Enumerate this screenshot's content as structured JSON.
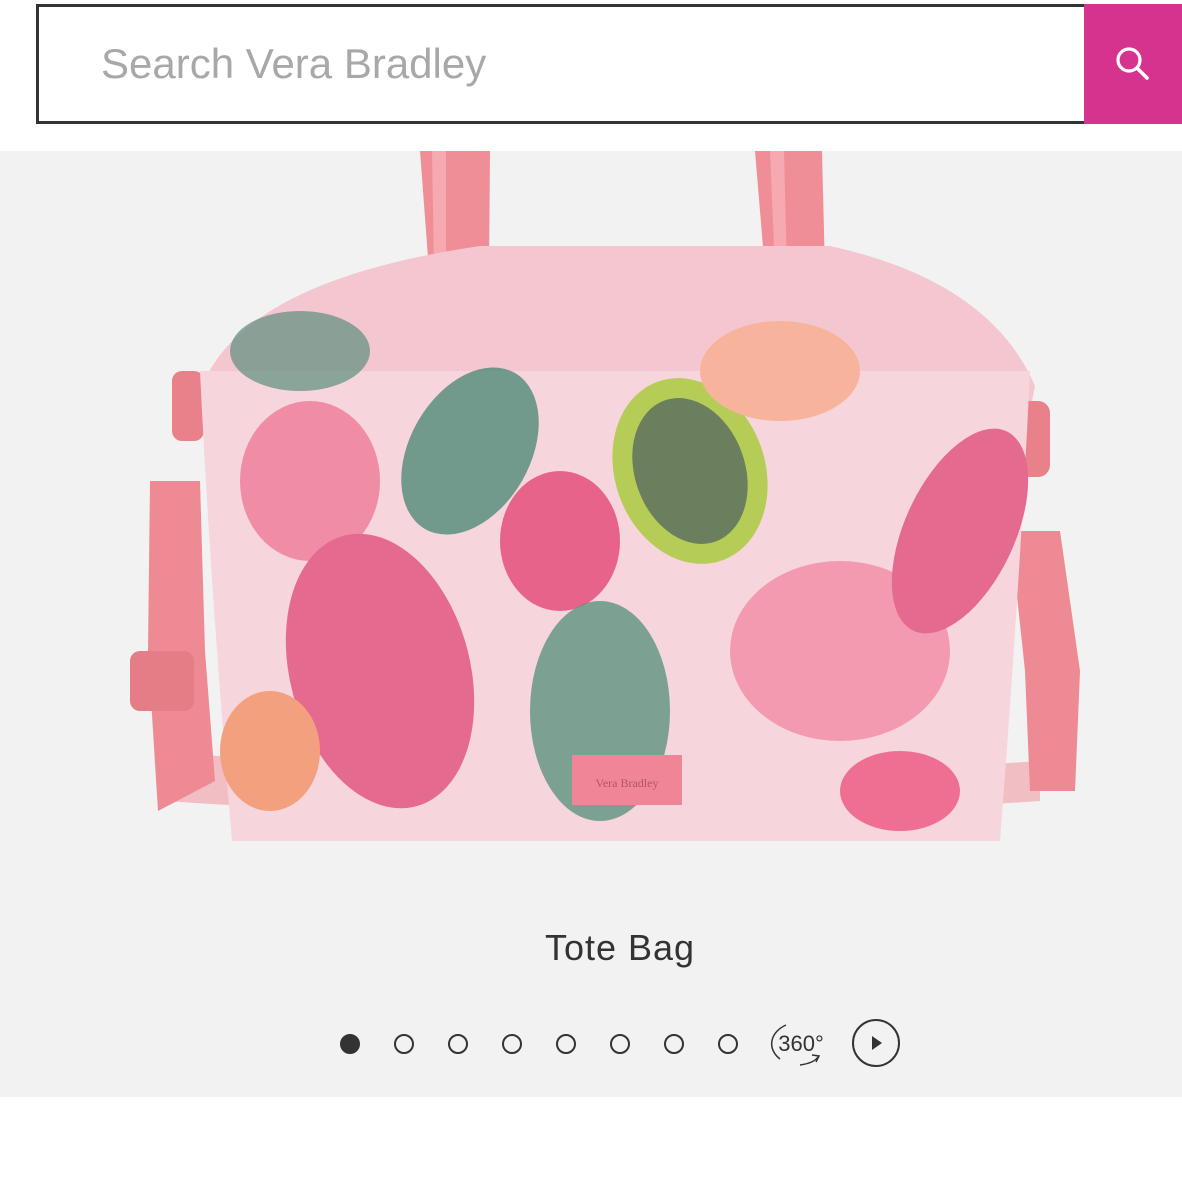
{
  "search": {
    "placeholder": "Search Vera Bradley",
    "value": "",
    "button_icon": "search-icon",
    "accent_color": "#d6338f"
  },
  "gallery": {
    "background_color": "#f2f2f2",
    "product": {
      "title": "Tote Bag",
      "bag_label": "Vera Bradley"
    },
    "pager": {
      "total_images": 8,
      "active_index": 0,
      "spin_label": "360°",
      "play_icon": "play-icon",
      "spin_icon": "rotate-360-icon"
    }
  }
}
